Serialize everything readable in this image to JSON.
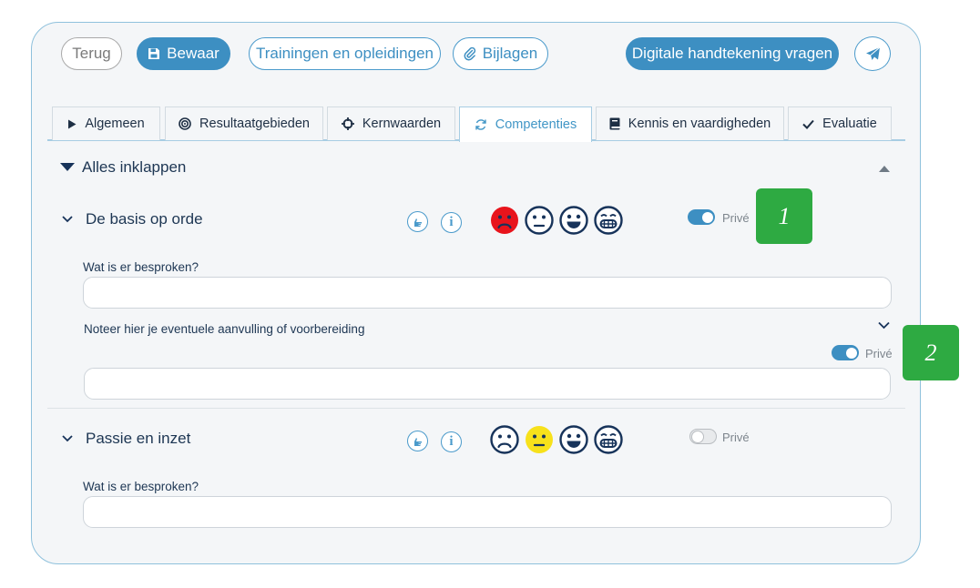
{
  "toolbar": {
    "back_label": "Terug",
    "save_label": "Bewaar",
    "trainings_label": "Trainingen en opleidingen",
    "attachments_label": "Bijlagen",
    "signature_label": "Digitale handtekening vragen"
  },
  "tabs": [
    {
      "label": "Algemeen",
      "icon": "play-icon"
    },
    {
      "label": "Resultaatgebieden",
      "icon": "target-icon"
    },
    {
      "label": "Kernwaarden",
      "icon": "crosshair-icon"
    },
    {
      "label": "Competenties",
      "icon": "refresh-icon",
      "active": true
    },
    {
      "label": "Kennis en vaardigheden",
      "icon": "book-icon"
    },
    {
      "label": "Evaluatie",
      "icon": "check-icon"
    }
  ],
  "collapse_all_label": "Alles inklappen",
  "sections": [
    {
      "title": "De basis op orde",
      "selected_rating": "sad",
      "private_label": "Privé",
      "private_on": true,
      "question_label": "Wat is er besproken?",
      "question_value": "",
      "note_label": "Noteer hier je eventuele aanvulling of voorbereiding",
      "note_private_label": "Privé",
      "note_private_on": true,
      "note_value": ""
    },
    {
      "title": "Passie en inzet",
      "selected_rating": "neutral",
      "private_label": "Privé",
      "private_on": false,
      "question_label": "Wat is er besproken?",
      "question_value": ""
    }
  ],
  "badges": [
    "1",
    "2"
  ],
  "colors": {
    "accent": "#3d8fc2",
    "sad_selected": "#e8141c",
    "neutral_selected": "#f7e11b",
    "badge": "#2eaa42",
    "icon_dark": "#17335a"
  }
}
